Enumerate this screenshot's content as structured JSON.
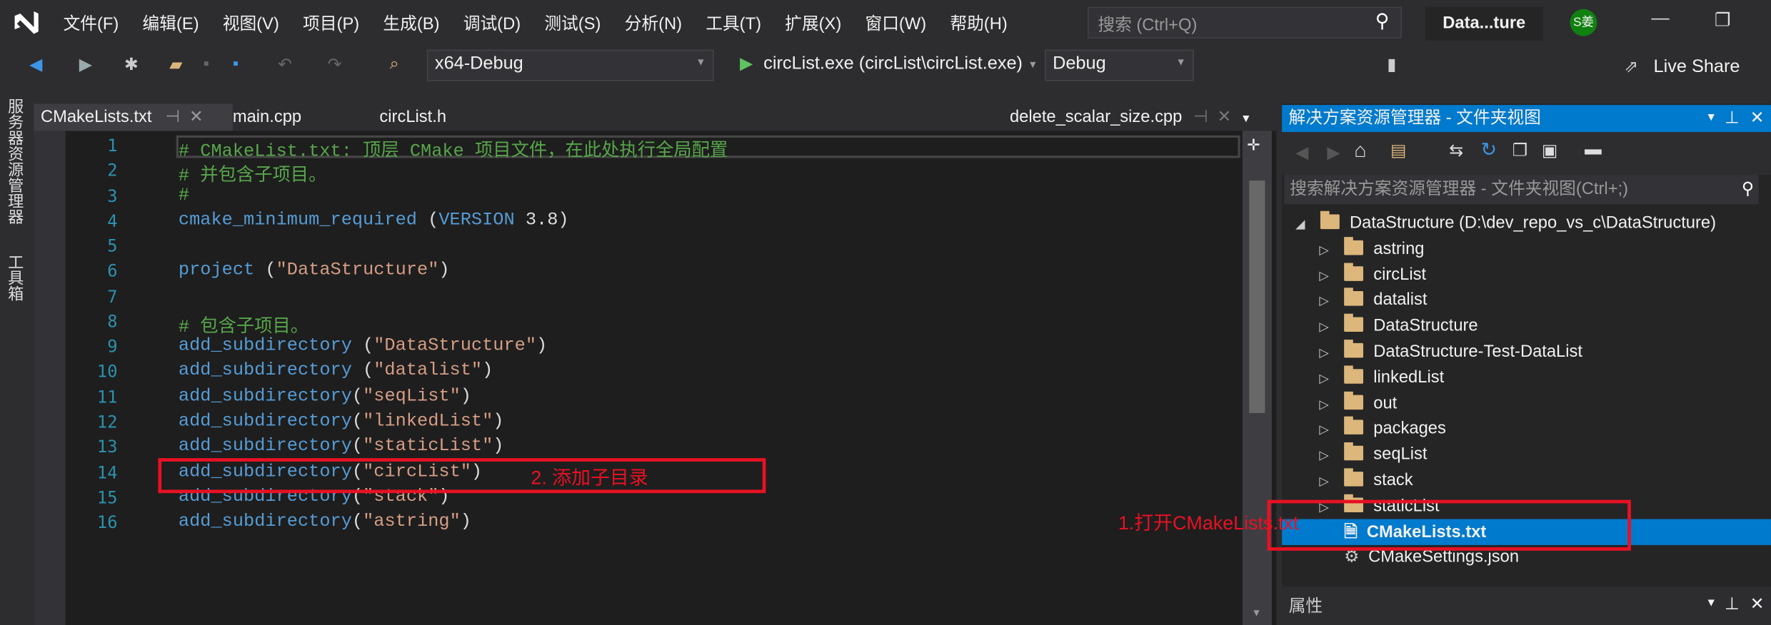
{
  "menu": {
    "items": [
      "文件(F)",
      "编辑(E)",
      "视图(V)",
      "项目(P)",
      "生成(B)",
      "调试(D)",
      "测试(S)",
      "分析(N)",
      "工具(T)",
      "扩展(X)",
      "窗口(W)",
      "帮助(H)"
    ],
    "search_placeholder": "搜索 (Ctrl+Q)",
    "solution_name": "Data...ture",
    "avatar": "S姜"
  },
  "toolbar": {
    "platform": "x64-Debug",
    "startup": "circList.exe (circList\\circList.exe)",
    "config": "Debug",
    "live_share": "Live Share"
  },
  "left_strip": [
    "服务器资源管理器",
    "工具箱"
  ],
  "tabs": [
    {
      "label": "CMakeLists.txt",
      "active": true
    },
    {
      "label": "main.cpp"
    },
    {
      "label": "circList.h"
    },
    {
      "label": "delete_scalar_size.cpp"
    }
  ],
  "editor": {
    "lines": [
      [
        [
          "# CMakeList.txt: 顶层 CMake 项目文件，在此处执行全局配置",
          "comment"
        ]
      ],
      [
        [
          "# 并包含子项目。",
          "comment"
        ]
      ],
      [
        [
          "#",
          "comment"
        ]
      ],
      [
        [
          "cmake_minimum_required",
          "func"
        ],
        [
          " (",
          "punc"
        ],
        [
          "VERSION",
          "kw"
        ],
        [
          " 3.8",
          "num"
        ],
        [
          ")",
          "punc"
        ]
      ],
      [],
      [
        [
          "project",
          "func"
        ],
        [
          " (",
          "punc"
        ],
        [
          "\"DataStructure\"",
          "str"
        ],
        [
          ")",
          "punc"
        ]
      ],
      [],
      [
        [
          "# 包含子项目。",
          "comment"
        ]
      ],
      [
        [
          "add_subdirectory",
          "func"
        ],
        [
          " (",
          "punc"
        ],
        [
          "\"DataStructure\"",
          "str"
        ],
        [
          ")",
          "punc"
        ]
      ],
      [
        [
          "add_subdirectory",
          "func"
        ],
        [
          " (",
          "punc"
        ],
        [
          "\"datalist\"",
          "str"
        ],
        [
          ")",
          "punc"
        ]
      ],
      [
        [
          "add_subdirectory",
          "func"
        ],
        [
          "(",
          "punc"
        ],
        [
          "\"seqList\"",
          "str"
        ],
        [
          ")",
          "punc"
        ]
      ],
      [
        [
          "add_subdirectory",
          "func"
        ],
        [
          "(",
          "punc"
        ],
        [
          "\"linkedList\"",
          "str"
        ],
        [
          ")",
          "punc"
        ]
      ],
      [
        [
          "add_subdirectory",
          "func"
        ],
        [
          "(",
          "punc"
        ],
        [
          "\"staticList\"",
          "str"
        ],
        [
          ")",
          "punc"
        ]
      ],
      [
        [
          "add_subdirectory",
          "func"
        ],
        [
          "(",
          "punc"
        ],
        [
          "\"circList\"",
          "str"
        ],
        [
          ")",
          "punc"
        ]
      ],
      [
        [
          "add_subdirectory",
          "func"
        ],
        [
          "(",
          "punc"
        ],
        [
          "\"stack\"",
          "str"
        ],
        [
          ")",
          "punc"
        ]
      ],
      [
        [
          "add_subdirectory",
          "func"
        ],
        [
          "(",
          "punc"
        ],
        [
          "\"astring\"",
          "str"
        ],
        [
          ")",
          "punc"
        ]
      ]
    ]
  },
  "explorer": {
    "title": "解决方案资源管理器 - 文件夹视图",
    "search_placeholder": "搜索解决方案资源管理器 - 文件夹视图(Ctrl+;)",
    "root": "DataStructure (D:\\dev_repo_vs_c\\DataStructure)",
    "folders": [
      "astring",
      "circList",
      "datalist",
      "DataStructure",
      "DataStructure-Test-DataList",
      "linkedList",
      "out",
      "packages",
      "seqList",
      "stack",
      "staticList"
    ],
    "files": [
      {
        "name": "CMakeLists.txt",
        "selected": true
      },
      {
        "name": "CMakeSettings.json"
      }
    ]
  },
  "properties": {
    "title": "属性"
  },
  "annotations": {
    "step1": "1.打开CMakeLists.txt",
    "step2": "2. 添加子目录",
    "color": "#e81123"
  },
  "colors": {
    "accent": "#007acc",
    "comment": "#57a64a",
    "function": "#569cd6",
    "string": "#d69d85"
  }
}
